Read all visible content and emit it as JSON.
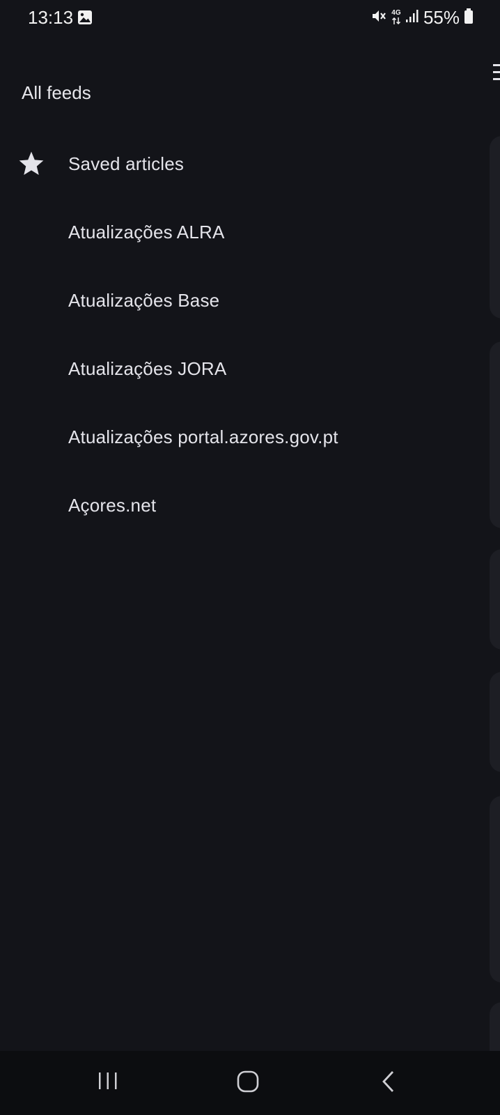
{
  "status_bar": {
    "time": "13:13",
    "network": "4G",
    "battery": "55%"
  },
  "drawer": {
    "title": "All feeds",
    "items": [
      {
        "label": "Saved articles",
        "icon": "star-icon"
      },
      {
        "label": "Atualizações ALRA"
      },
      {
        "label": "Atualizações Base"
      },
      {
        "label": "Atualizações JORA"
      },
      {
        "label": "Atualizações portal.azores.gov.pt"
      },
      {
        "label": "Açores.net"
      }
    ]
  },
  "colors": {
    "background": "#131419",
    "text": "#e4e4ea",
    "nav_bar": "#0c0d10"
  }
}
